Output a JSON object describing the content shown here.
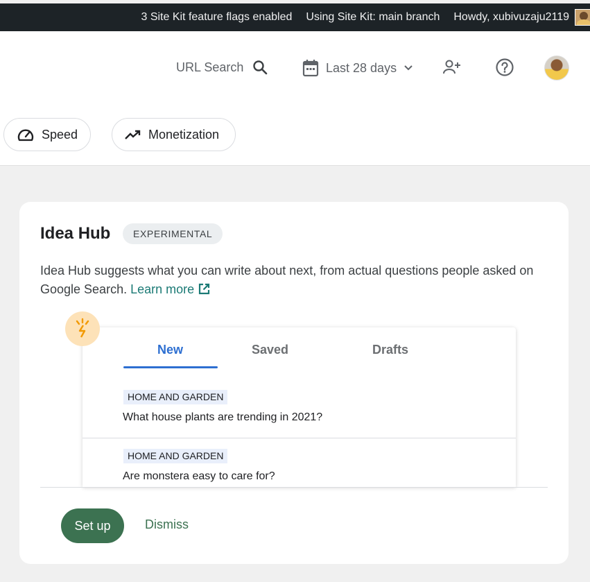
{
  "adminbar": {
    "flags": "3 Site Kit feature flags enabled",
    "branch": "Using Site Kit: main branch",
    "howdy": "Howdy, xubivuzaju2119"
  },
  "header": {
    "url_search": "URL Search",
    "date_range": "Last 28 days",
    "chips": [
      {
        "label": "Speed",
        "icon": "speedometer-icon"
      },
      {
        "label": "Monetization",
        "icon": "trending-up-icon"
      }
    ]
  },
  "card": {
    "title": "Idea Hub",
    "badge": "EXPERIMENTAL",
    "description": "Idea Hub suggests what you can write about next, from actual questions people asked on Google Search.",
    "learn_more": "Learn more",
    "tabs": [
      "New",
      "Saved",
      "Drafts"
    ],
    "ideas": [
      {
        "topic": "HOME AND GARDEN",
        "question": "What house plants are trending in 2021?"
      },
      {
        "topic": "HOME AND GARDEN",
        "question": "Are monstera easy to care for?"
      }
    ],
    "setup_label": "Set up",
    "dismiss_label": "Dismiss"
  },
  "colors": {
    "accent_green": "#3c7251",
    "tab_blue": "#2d6fd1",
    "link_teal": "#1b7a75"
  }
}
